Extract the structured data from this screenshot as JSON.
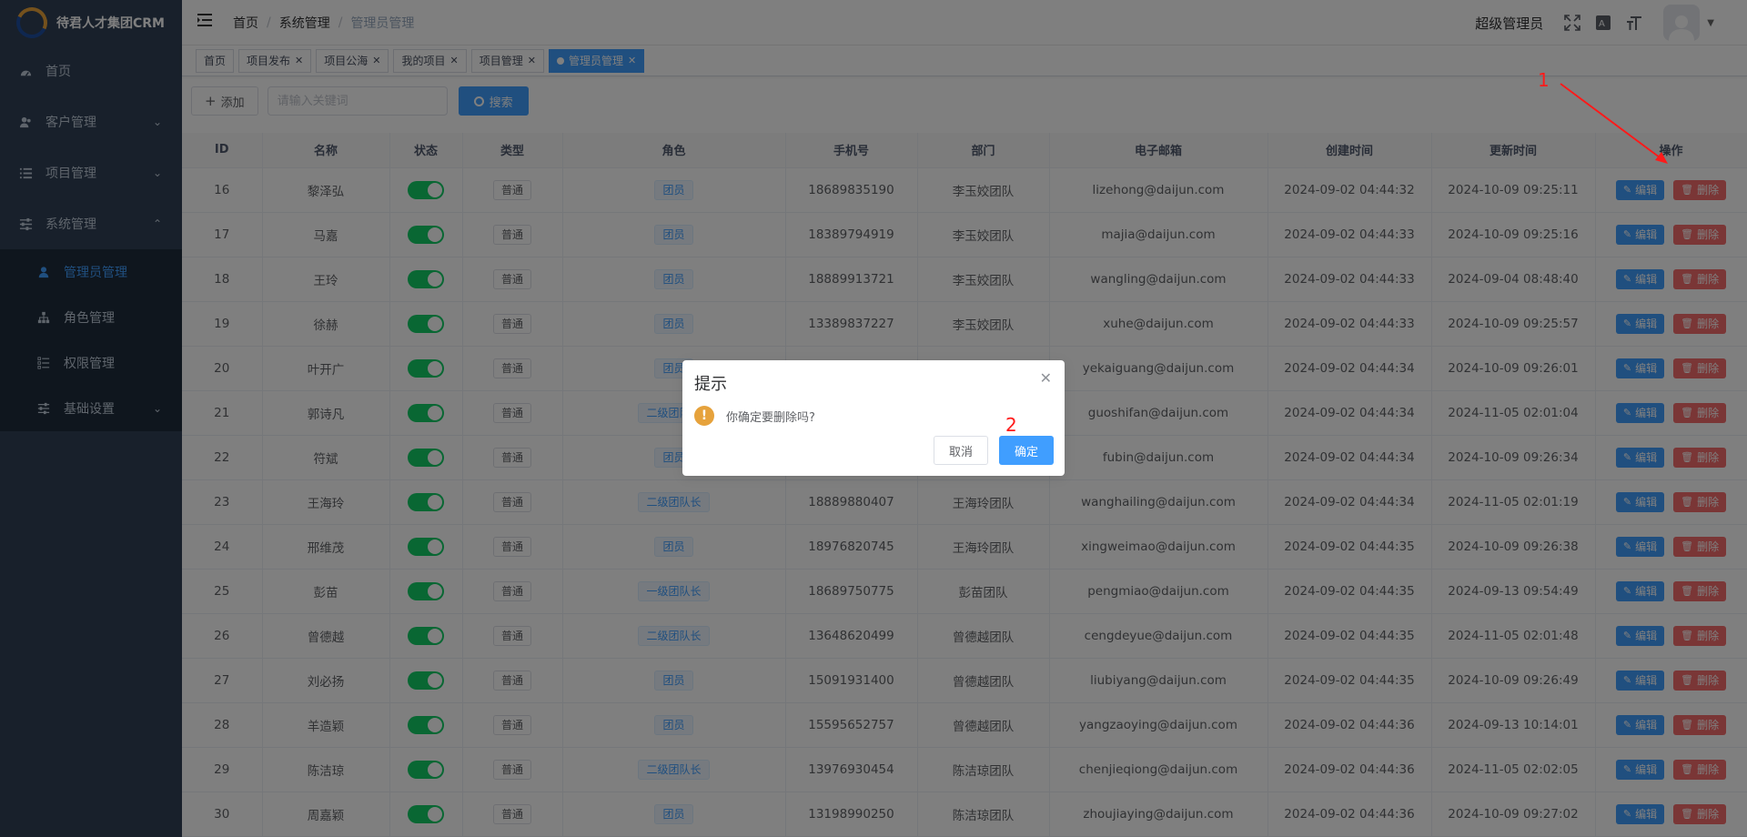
{
  "app": {
    "title": "待君人才集团CRM"
  },
  "sidebar": {
    "items": [
      {
        "label": "首页",
        "icon": "dashboard-icon"
      },
      {
        "label": "客户管理",
        "icon": "user-group-icon"
      },
      {
        "label": "项目管理",
        "icon": "list-icon"
      },
      {
        "label": "系统管理",
        "icon": "sliders-icon"
      }
    ],
    "sub_items": [
      {
        "label": "管理员管理",
        "icon": "user-icon"
      },
      {
        "label": "角色管理",
        "icon": "tree-icon"
      },
      {
        "label": "权限管理",
        "icon": "checklist-icon"
      },
      {
        "label": "基础设置",
        "icon": "sliders-icon"
      }
    ]
  },
  "header": {
    "breadcrumb": [
      "首页",
      "系统管理",
      "管理员管理"
    ],
    "user": "超级管理员"
  },
  "tabs": [
    {
      "label": "首页"
    },
    {
      "label": "项目发布"
    },
    {
      "label": "项目公海"
    },
    {
      "label": "我的项目"
    },
    {
      "label": "项目管理"
    },
    {
      "label": "管理员管理"
    }
  ],
  "toolbar": {
    "add_label": "添加",
    "search_placeholder": "请输入关键词",
    "search_label": "搜索"
  },
  "table": {
    "columns": [
      "ID",
      "名称",
      "状态",
      "类型",
      "角色",
      "手机号",
      "部门",
      "电子邮箱",
      "创建时间",
      "更新时间",
      "操作"
    ],
    "edit_label": "编辑",
    "delete_label": "删除",
    "rows": [
      {
        "id": "16",
        "name": "黎泽弘",
        "type": "普通",
        "role": "团员",
        "phone": "18689835190",
        "dept": "李玉姣团队",
        "email": "lizehong@daijun.com",
        "created": "2024-09-02 04:44:32",
        "updated": "2024-10-09 09:25:11"
      },
      {
        "id": "17",
        "name": "马嘉",
        "type": "普通",
        "role": "团员",
        "phone": "18389794919",
        "dept": "李玉姣团队",
        "email": "majia@daijun.com",
        "created": "2024-09-02 04:44:33",
        "updated": "2024-10-09 09:25:16"
      },
      {
        "id": "18",
        "name": "王玲",
        "type": "普通",
        "role": "团员",
        "phone": "18889913721",
        "dept": "李玉姣团队",
        "email": "wangling@daijun.com",
        "created": "2024-09-02 04:44:33",
        "updated": "2024-09-04 08:48:40"
      },
      {
        "id": "19",
        "name": "徐赫",
        "type": "普通",
        "role": "团员",
        "phone": "13389837227",
        "dept": "李玉姣团队",
        "email": "xuhe@daijun.com",
        "created": "2024-09-02 04:44:33",
        "updated": "2024-10-09 09:25:57"
      },
      {
        "id": "20",
        "name": "叶开广",
        "type": "普通",
        "role": "团员",
        "phone": "",
        "dept": "",
        "email": "yekaiguang@daijun.com",
        "created": "2024-09-02 04:44:34",
        "updated": "2024-10-09 09:26:01"
      },
      {
        "id": "21",
        "name": "郭诗凡",
        "type": "普通",
        "role": "二级团队长",
        "phone": "",
        "dept": "",
        "email": "guoshifan@daijun.com",
        "created": "2024-09-02 04:44:34",
        "updated": "2024-11-05 02:01:04"
      },
      {
        "id": "22",
        "name": "符斌",
        "type": "普通",
        "role": "团员",
        "phone": "",
        "dept": "",
        "email": "fubin@daijun.com",
        "created": "2024-09-02 04:44:34",
        "updated": "2024-10-09 09:26:34"
      },
      {
        "id": "23",
        "name": "王海玲",
        "type": "普通",
        "role": "二级团队长",
        "phone": "18889880407",
        "dept": "王海玲团队",
        "email": "wanghailing@daijun.com",
        "created": "2024-09-02 04:44:34",
        "updated": "2024-11-05 02:01:19"
      },
      {
        "id": "24",
        "name": "邢维茂",
        "type": "普通",
        "role": "团员",
        "phone": "18976820745",
        "dept": "王海玲团队",
        "email": "xingweimao@daijun.com",
        "created": "2024-09-02 04:44:35",
        "updated": "2024-10-09 09:26:38"
      },
      {
        "id": "25",
        "name": "彭苗",
        "type": "普通",
        "role": "一级团队长",
        "phone": "18689750775",
        "dept": "彭苗团队",
        "email": "pengmiao@daijun.com",
        "created": "2024-09-02 04:44:35",
        "updated": "2024-09-13 09:54:49"
      },
      {
        "id": "26",
        "name": "曾德越",
        "type": "普通",
        "role": "二级团队长",
        "phone": "13648620499",
        "dept": "曾德越团队",
        "email": "cengdeyue@daijun.com",
        "created": "2024-09-02 04:44:35",
        "updated": "2024-11-05 02:01:48"
      },
      {
        "id": "27",
        "name": "刘必扬",
        "type": "普通",
        "role": "团员",
        "phone": "15091931400",
        "dept": "曾德越团队",
        "email": "liubiyang@daijun.com",
        "created": "2024-09-02 04:44:35",
        "updated": "2024-10-09 09:26:49"
      },
      {
        "id": "28",
        "name": "羊造颖",
        "type": "普通",
        "role": "团员",
        "phone": "15595652757",
        "dept": "曾德越团队",
        "email": "yangzaoying@daijun.com",
        "created": "2024-09-02 04:44:36",
        "updated": "2024-09-13 10:14:01"
      },
      {
        "id": "29",
        "name": "陈洁琼",
        "type": "普通",
        "role": "二级团队长",
        "phone": "13976930454",
        "dept": "陈洁琼团队",
        "email": "chenjieqiong@daijun.com",
        "created": "2024-09-02 04:44:36",
        "updated": "2024-11-05 02:02:05"
      },
      {
        "id": "30",
        "name": "周嘉颖",
        "type": "普通",
        "role": "团员",
        "phone": "13198990250",
        "dept": "陈洁琼团队",
        "email": "zhoujiaying@daijun.com",
        "created": "2024-09-02 04:44:36",
        "updated": "2024-10-09 09:27:02"
      }
    ]
  },
  "dialog": {
    "title": "提示",
    "message": "你确定要删除吗?",
    "cancel_label": "取消",
    "confirm_label": "确定"
  },
  "annotations": {
    "step1": "1",
    "step2": "2",
    "color": "#ff1a1a"
  },
  "colors": {
    "primary": "#409eff",
    "danger": "#f56c6c",
    "success": "#13ce66",
    "sidebar": "#304156"
  }
}
